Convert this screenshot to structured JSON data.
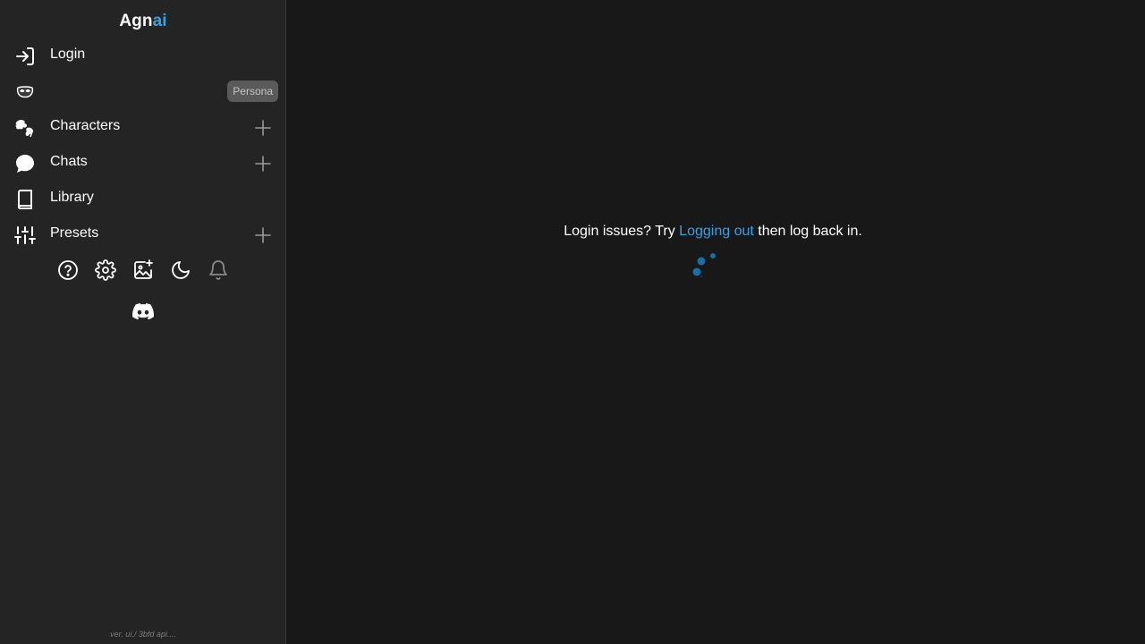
{
  "brand": {
    "part1": "Agn",
    "part2": "ai"
  },
  "sidebar": {
    "items": [
      {
        "label": "Login",
        "icon": "login-icon"
      },
      {
        "label": "",
        "icon": "persona-mask-icon",
        "badge": "Persona"
      },
      {
        "label": "Characters",
        "icon": "characters-icon",
        "action": "add-icon"
      },
      {
        "label": "Chats",
        "icon": "chat-bubble-icon",
        "action": "add-icon"
      },
      {
        "label": "Library",
        "icon": "book-icon"
      },
      {
        "label": "Presets",
        "icon": "sliders-icon",
        "action": "add-icon"
      }
    ],
    "toolbar": [
      "help-icon",
      "settings-gear-icon",
      "image-add-icon",
      "dark-mode-moon-icon",
      "notification-bell-icon"
    ],
    "discord": "discord-icon",
    "version": "ver. ui./ 3bfd api...."
  },
  "main": {
    "message_before": "Login issues? Try ",
    "message_link": "Logging out",
    "message_after": " then log back in."
  },
  "colors": {
    "background": "#181818",
    "sidebar": "#242424",
    "accent": "#3aa0e4",
    "spinner": "#1a6ea8"
  }
}
